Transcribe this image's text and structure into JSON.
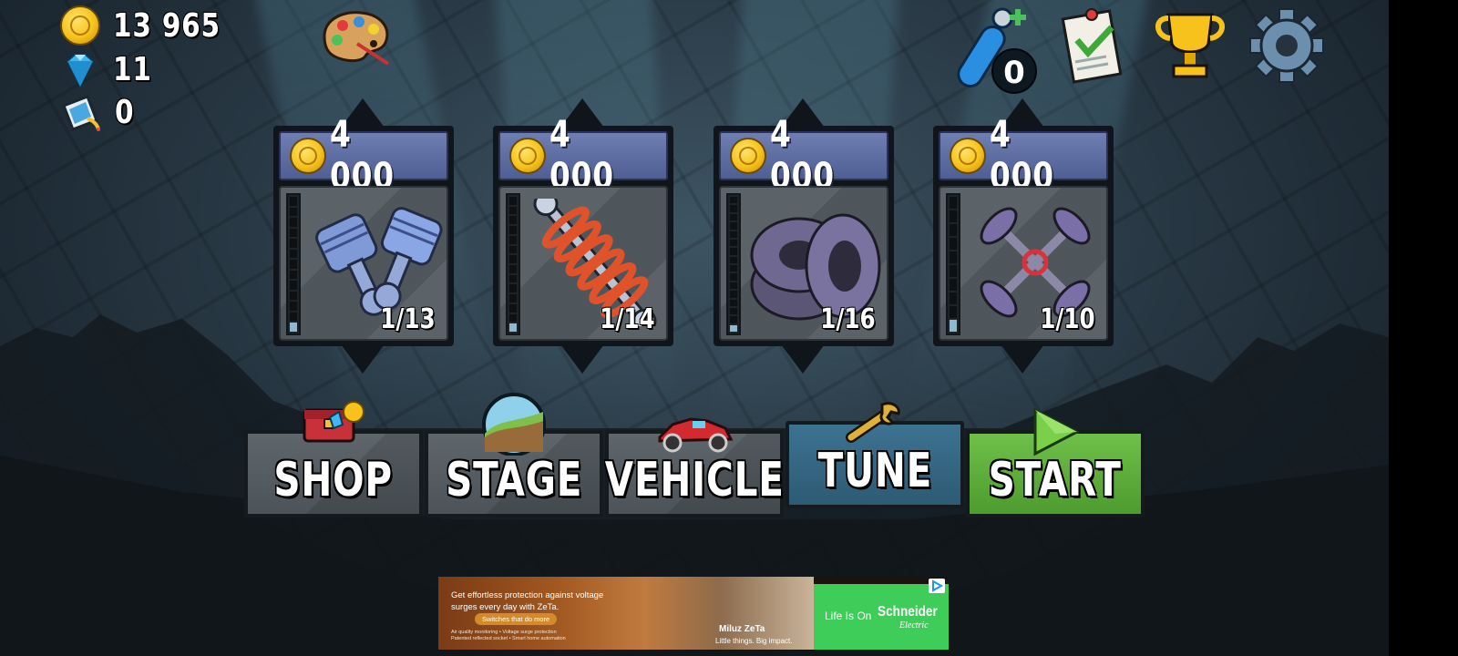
{
  "currency": {
    "coins": "13 965",
    "gems": "11",
    "paint": "0"
  },
  "boost_count": "0",
  "upgrades": [
    {
      "name": "engine",
      "price": "4 000",
      "level_text": "1/13",
      "level": 1,
      "max": 13
    },
    {
      "name": "suspension",
      "price": "4 000",
      "level_text": "1/14",
      "level": 1,
      "max": 14
    },
    {
      "name": "tires",
      "price": "4 000",
      "level_text": "1/16",
      "level": 1,
      "max": 16
    },
    {
      "name": "4wd",
      "price": "4 000",
      "level_text": "1/10",
      "level": 1,
      "max": 10
    }
  ],
  "nav": {
    "shop": "SHOP",
    "stage": "STAGE",
    "vehicle": "VEHICLE",
    "tune": "TUNE",
    "start": "START"
  },
  "ad": {
    "headline": "Get effortless protection against voltage surges every day with ZeTa.",
    "pill": "Switches that do more",
    "small": "Air quality monitoring • Voltage surge protection Patented reflected socket • Smart home automation",
    "product": "Miluz ZeTa",
    "tagline": "Little things. Big impact.",
    "slogan": "Life Is On",
    "brand": "Schneider",
    "brand_sub": "Electric"
  },
  "colors": {
    "tune_active": "#2e5a74",
    "start": "#5aad38",
    "price_bar": "#5b6aa0",
    "meter_on": "#8fb9d1"
  },
  "icons": [
    "coin-icon",
    "gem-icon",
    "paint-bucket-icon",
    "palette-icon",
    "boost-icon",
    "missions-clipboard-icon",
    "trophy-icon",
    "gear-icon"
  ]
}
